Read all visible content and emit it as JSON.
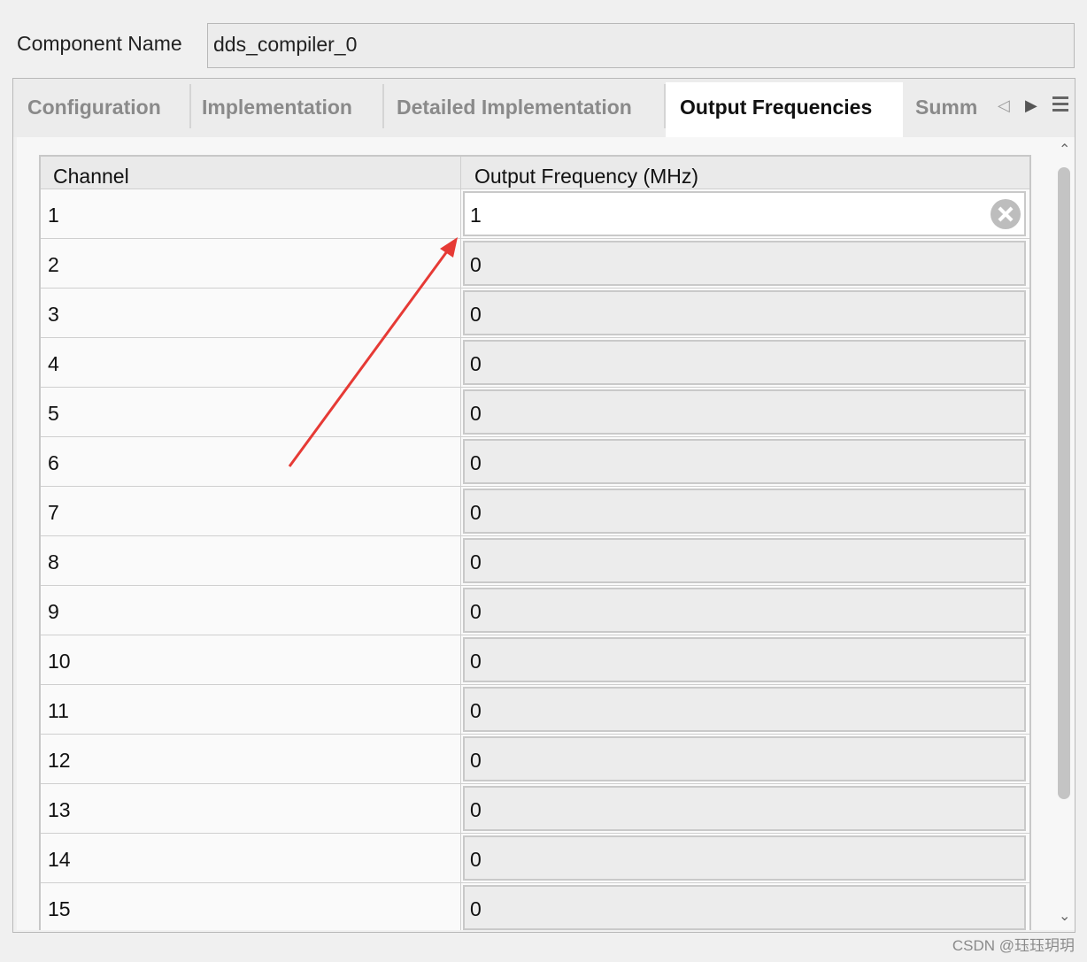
{
  "component_name": {
    "label": "Component Name",
    "value": "dds_compiler_0"
  },
  "tabs": [
    {
      "label": "Configuration",
      "active": false
    },
    {
      "label": "Implementation",
      "active": false
    },
    {
      "label": "Detailed Implementation",
      "active": false
    },
    {
      "label": "Output Frequencies",
      "active": true
    },
    {
      "label": "Summ",
      "active": false
    }
  ],
  "tab_controls": {
    "prev_icon": "caret-left-icon",
    "next_icon": "caret-right-icon",
    "menu_icon": "hamburger-menu-icon"
  },
  "table": {
    "headers": [
      "Channel",
      "Output Frequency (MHz)"
    ],
    "rows": [
      {
        "channel": "1",
        "freq": "1"
      },
      {
        "channel": "2",
        "freq": "0"
      },
      {
        "channel": "3",
        "freq": "0"
      },
      {
        "channel": "4",
        "freq": "0"
      },
      {
        "channel": "5",
        "freq": "0"
      },
      {
        "channel": "6",
        "freq": "0"
      },
      {
        "channel": "7",
        "freq": "0"
      },
      {
        "channel": "8",
        "freq": "0"
      },
      {
        "channel": "9",
        "freq": "0"
      },
      {
        "channel": "10",
        "freq": "0"
      },
      {
        "channel": "11",
        "freq": "0"
      },
      {
        "channel": "12",
        "freq": "0"
      },
      {
        "channel": "13",
        "freq": "0"
      },
      {
        "channel": "14",
        "freq": "0"
      },
      {
        "channel": "15",
        "freq": "0"
      }
    ],
    "editing_row": 0
  },
  "annotation": {
    "color": "#e63a35",
    "type": "red-arrow"
  },
  "watermark": "CSDN @珏珏玥玥"
}
